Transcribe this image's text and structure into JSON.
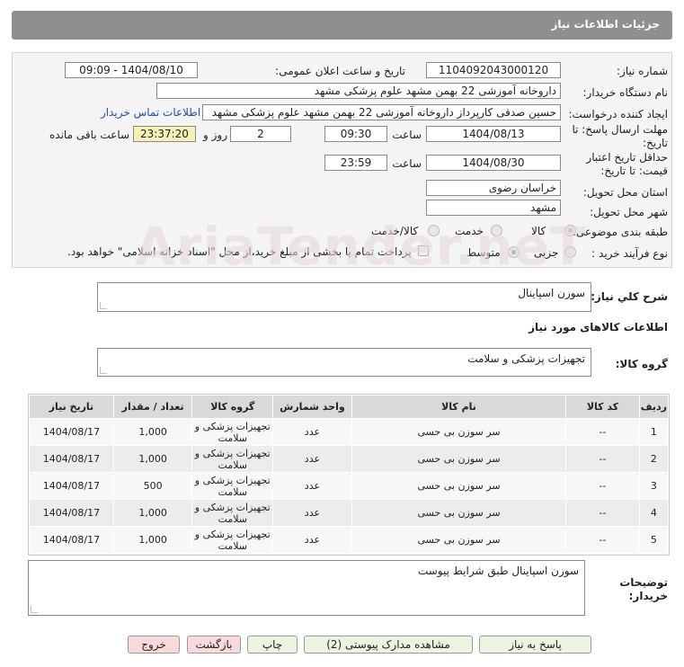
{
  "header": {
    "title": "جزئیات اطلاعات نیاز"
  },
  "form": {
    "need_number_label": "شماره نیاز:",
    "need_number": "1104092043000120",
    "announce_label": "تاریخ و ساعت اعلان عمومی:",
    "announce_value": "1404/08/10 - 09:09",
    "buyer_org_label": "نام دستگاه خریدار:",
    "buyer_org": "داروخانه آموزشی 22 بهمن مشهد   علوم پزشکی مشهد",
    "creator_label": "ایجاد کننده درخواست:",
    "creator": "حسین صدقی کارپرداز داروخانه آموزشی 22 بهمن مشهد   علوم پزشکی مشهد",
    "contact_link": "اطلاعات تماس خریدار",
    "deadline_label_1": "مهلت ارسال پاسخ: تا",
    "deadline_label_2": "تاریخ:",
    "deadline_date": "1404/08/13",
    "time_label": "ساعت",
    "deadline_time": "09:30",
    "days_value": "2",
    "days_and_label": "روز و",
    "remaining_time": "23:37:20",
    "remaining_label": "ساعت باقی مانده",
    "validity_label_1": "حداقل تاریخ اعتبار",
    "validity_label_2": "قیمت: تا تاریخ:",
    "validity_date": "1404/08/30",
    "validity_time": "23:59",
    "province_label": "استان محل تحویل:",
    "province": "خراسان رضوی",
    "city_label": "شهر محل تحویل:",
    "city": "مشهد",
    "category_label": "طبقه بندی موضوعی:",
    "category_options": [
      "کالا",
      "خدمت",
      "کالا/خدمت"
    ],
    "process_label": "نوع فرآیند خرید :",
    "process_options": [
      "جزیی",
      "متوسط"
    ],
    "payment_note": "پرداخت تمام یا بخشی از مبلغ خرید،از محل \"اسناد خزانه اسلامی\" خواهد بود."
  },
  "summary": {
    "label": "شرح کلي نیاز:",
    "value": "سوزن اسپاینال"
  },
  "goods_info_title": "اطلاعات کالاهای مورد نیاز",
  "goods_group": {
    "label": "گروه کالا:",
    "value": "تجهیزات پزشکی و سلامت"
  },
  "table": {
    "headers": [
      "ردیف",
      "کد کالا",
      "نام کالا",
      "واحد شمارش",
      "گروه کالا",
      "تعداد / مقدار",
      "تاریخ نیاز"
    ],
    "rows": [
      [
        "1",
        "--",
        "سر سوزن بی حسی",
        "عدد",
        "تجهیزات پزشکی و سلامت",
        "1,000",
        "1404/08/17"
      ],
      [
        "2",
        "--",
        "سر سوزن بی حسی",
        "عدد",
        "تجهیزات پزشکی و سلامت",
        "1,000",
        "1404/08/17"
      ],
      [
        "3",
        "--",
        "سر سوزن بی حسی",
        "عدد",
        "تجهیزات پزشکی و سلامت",
        "500",
        "1404/08/17"
      ],
      [
        "4",
        "--",
        "سر سوزن بی حسی",
        "عدد",
        "تجهیزات پزشکی و سلامت",
        "1,000",
        "1404/08/17"
      ],
      [
        "5",
        "--",
        "سر سوزن بی حسی",
        "عدد",
        "تجهیزات پزشکی و سلامت",
        "1,000",
        "1404/08/17"
      ]
    ]
  },
  "buyer_notes": {
    "label_1": "توضیحات",
    "label_2": "خریدار:",
    "value": "سوزن اسپاینال طبق شرایط پیوست"
  },
  "buttons": {
    "reply": "پاسخ به نیاز",
    "view_docs": "مشاهده مدارک پیوستی (2)",
    "print": "چاپ",
    "back": "بازگشت",
    "exit": "خروج"
  },
  "watermark": "AriaTender.neT"
}
